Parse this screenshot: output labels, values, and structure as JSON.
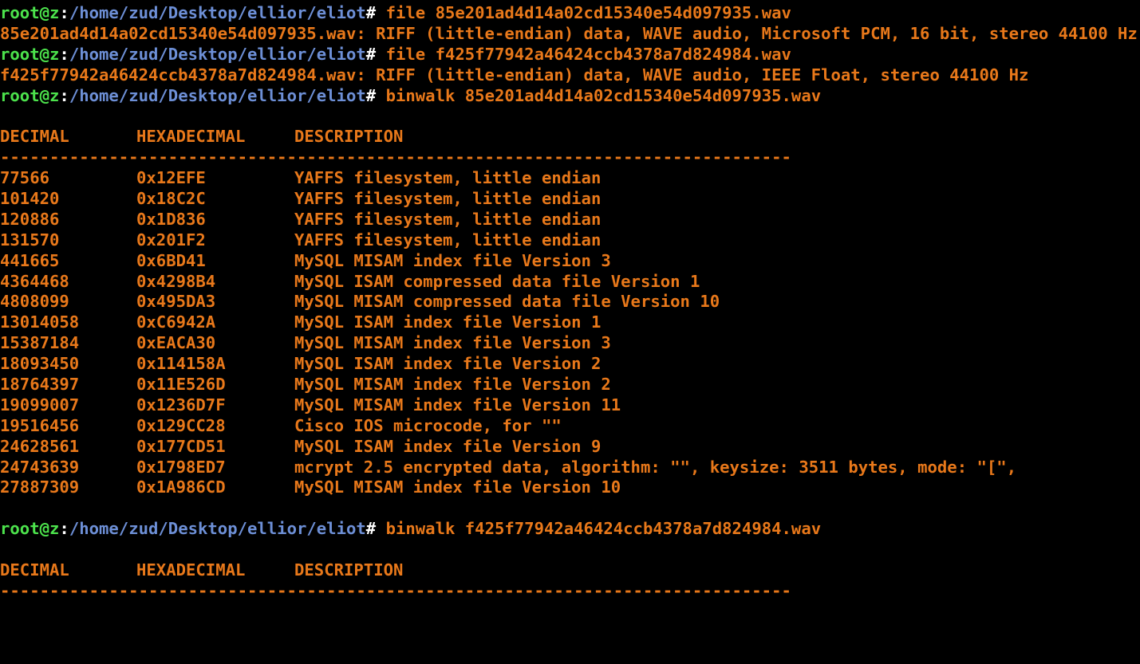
{
  "prompt": {
    "user_host": "root@z",
    "sep": ":",
    "path": "/home/zud/Desktop/ellior/eliot",
    "symbol": "#"
  },
  "session": {
    "cmd1": " file 85e201ad4d14a02cd15340e54d097935.wav",
    "out1": "85e201ad4d14a02cd15340e54d097935.wav: RIFF (little-endian) data, WAVE audio, Microsoft PCM, 16 bit, stereo 44100 Hz",
    "cmd2": " file f425f77942a46424ccb4378a7d824984.wav",
    "out2": "f425f77942a46424ccb4378a7d824984.wav: RIFF (little-endian) data, WAVE audio, IEEE Float, stereo 44100 Hz",
    "cmd3": " binwalk 85e201ad4d14a02cd15340e54d097935.wav",
    "cmd4": " binwalk f425f77942a46424ccb4378a7d824984.wav"
  },
  "table_headers": {
    "decimal": "DECIMAL",
    "hex": "HEXADECIMAL",
    "desc": "DESCRIPTION",
    "rule": "--------------------------------------------------------------------------------"
  },
  "binwalk1_rows": [
    {
      "decimal": "77566",
      "hex": "0x12EFE",
      "desc": "YAFFS filesystem, little endian"
    },
    {
      "decimal": "101420",
      "hex": "0x18C2C",
      "desc": "YAFFS filesystem, little endian"
    },
    {
      "decimal": "120886",
      "hex": "0x1D836",
      "desc": "YAFFS filesystem, little endian"
    },
    {
      "decimal": "131570",
      "hex": "0x201F2",
      "desc": "YAFFS filesystem, little endian"
    },
    {
      "decimal": "441665",
      "hex": "0x6BD41",
      "desc": "MySQL MISAM index file Version 3"
    },
    {
      "decimal": "4364468",
      "hex": "0x4298B4",
      "desc": "MySQL ISAM compressed data file Version 1"
    },
    {
      "decimal": "4808099",
      "hex": "0x495DA3",
      "desc": "MySQL MISAM compressed data file Version 10"
    },
    {
      "decimal": "13014058",
      "hex": "0xC6942A",
      "desc": "MySQL ISAM index file Version 1"
    },
    {
      "decimal": "15387184",
      "hex": "0xEACA30",
      "desc": "MySQL MISAM index file Version 3"
    },
    {
      "decimal": "18093450",
      "hex": "0x114158A",
      "desc": "MySQL ISAM index file Version 2"
    },
    {
      "decimal": "18764397",
      "hex": "0x11E526D",
      "desc": "MySQL MISAM index file Version 2"
    },
    {
      "decimal": "19099007",
      "hex": "0x1236D7F",
      "desc": "MySQL MISAM index file Version 11"
    },
    {
      "decimal": "19516456",
      "hex": "0x129CC28",
      "desc": "Cisco IOS microcode, for \"\""
    },
    {
      "decimal": "24628561",
      "hex": "0x177CD51",
      "desc": "MySQL ISAM index file Version 9"
    },
    {
      "decimal": "24743639",
      "hex": "0x1798ED7",
      "desc": "mcrypt 2.5 encrypted data, algorithm: \"\", keysize: 3511 bytes, mode: \"[\","
    },
    {
      "decimal": "27887309",
      "hex": "0x1A986CD",
      "desc": "MySQL MISAM index file Version 10"
    }
  ],
  "colors": {
    "background": "#000000",
    "output": "#e8781a",
    "user_host": "#4ce24c",
    "path": "#6d8fd6",
    "symbol": "#ffffff"
  }
}
